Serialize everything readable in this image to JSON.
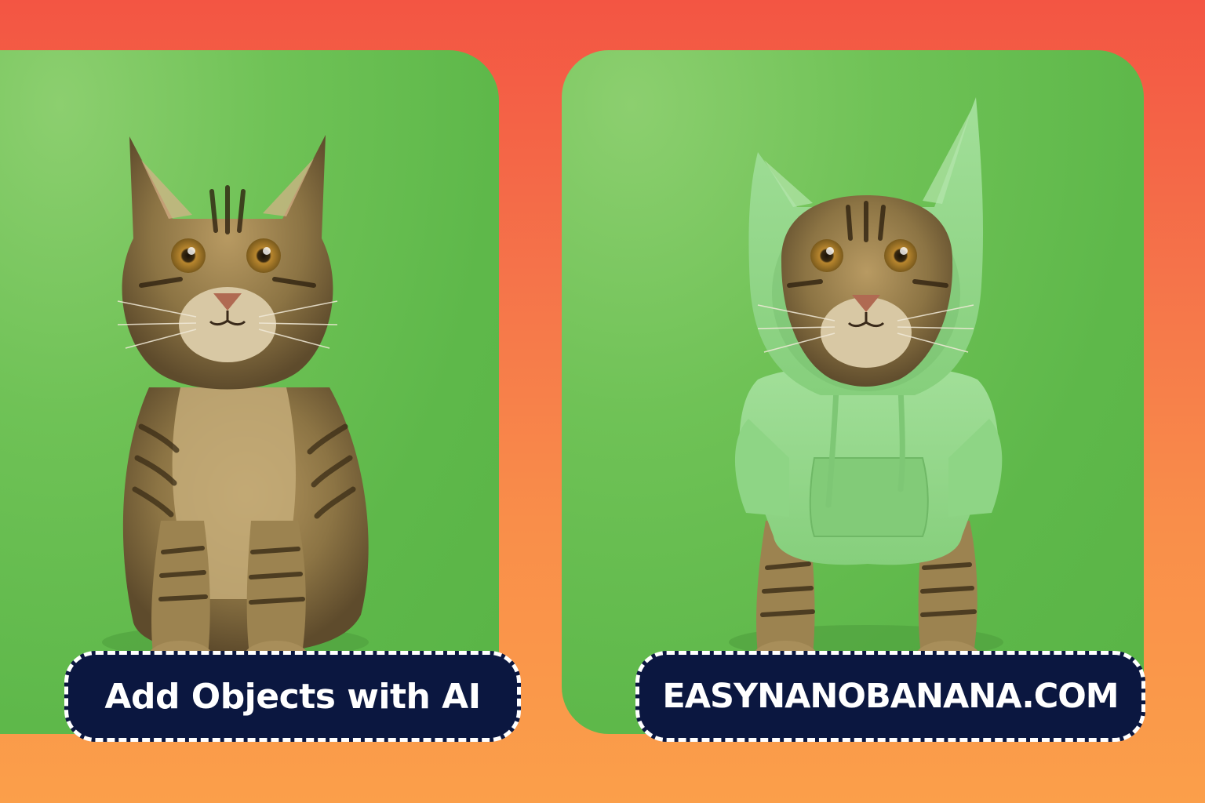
{
  "captions": {
    "left": "Add Objects with AI",
    "right": "EASYNANOBANANA.COM"
  },
  "panels": {
    "before": {
      "subject": "tabby kitten sitting",
      "background": "green"
    },
    "after": {
      "subject": "tabby kitten wearing green hoodie with cat ears",
      "background": "green"
    }
  },
  "colors": {
    "background_top": "#f35543",
    "background_bottom": "#fb9f4a",
    "panel_green": "#5eb84a",
    "label_bg": "#0b1740",
    "label_border": "#ffffff",
    "label_text": "#ffffff",
    "hoodie": "#8fd98a"
  }
}
